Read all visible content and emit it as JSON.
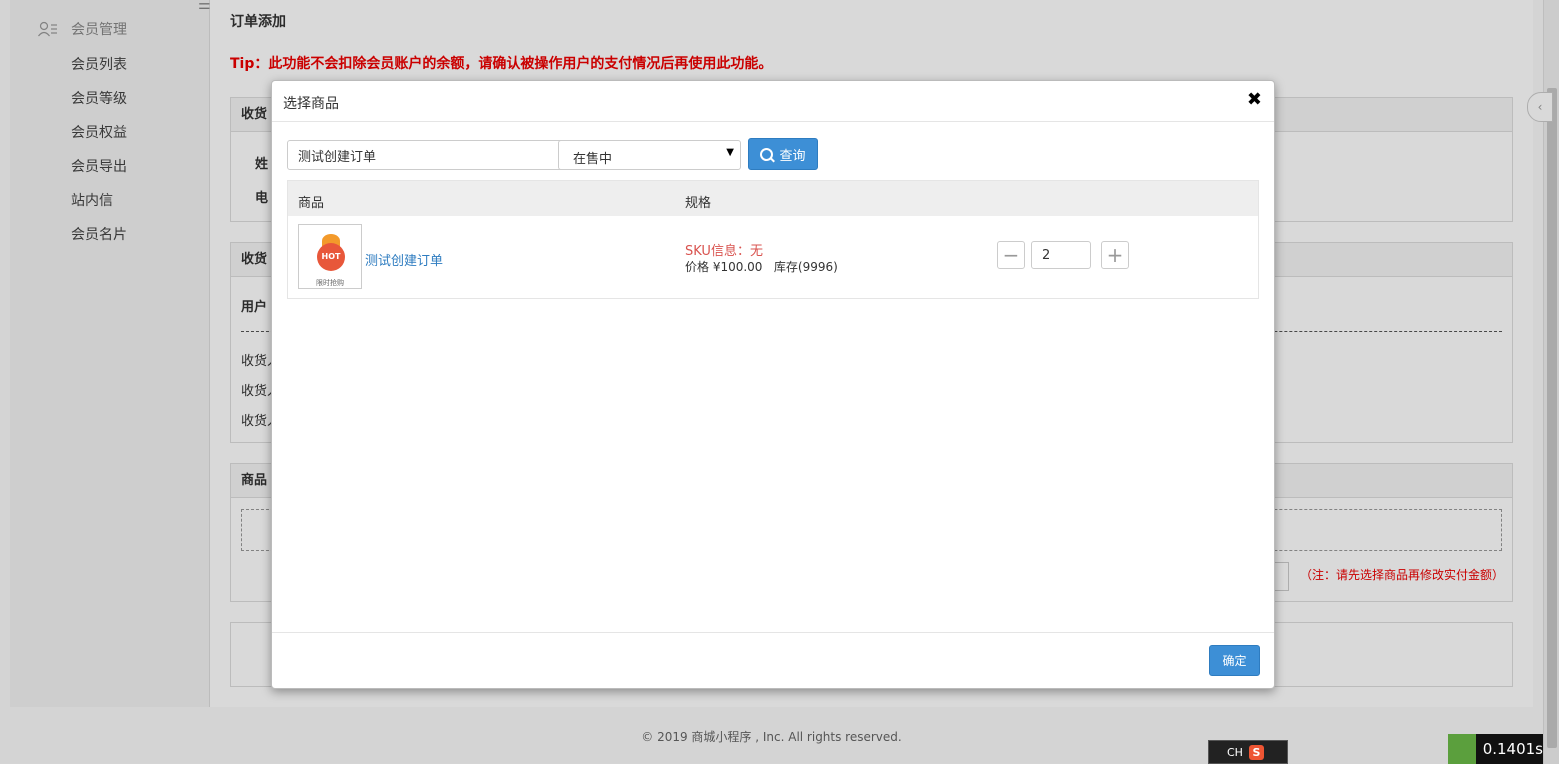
{
  "sidebar": {
    "section": "会员管理",
    "items": [
      {
        "label": "会员列表"
      },
      {
        "label": "会员等级"
      },
      {
        "label": "会员权益"
      },
      {
        "label": "会员导出"
      },
      {
        "label": "站内信"
      },
      {
        "label": "会员名片"
      }
    ]
  },
  "main": {
    "title": "订单添加",
    "tip": "Tip：此功能不会扣除会员账户的余额，请确认被操作用户的支付情况后再使用此功能。",
    "panel1": {
      "header": "收货",
      "label_name": "姓",
      "label_phone": "电"
    },
    "panel2": {
      "header": "收货",
      "label_user": "用户",
      "label_r1": "收货人",
      "label_r2": "收货人",
      "label_r3": "收货人"
    },
    "panel3": {
      "header": "商品",
      "note": "（注：请先选择商品再修改实付金额）"
    }
  },
  "footer": "© 2019 商城小程序 , Inc. All rights reserved.",
  "ime": {
    "label": "CH",
    "logo": "S"
  },
  "timer": "0.1401s",
  "modal": {
    "title": "选择商品",
    "search": {
      "value": "测试创建订单"
    },
    "status_select": {
      "value": "在售中"
    },
    "query_label": "查询",
    "columns": [
      "商品",
      "规格"
    ],
    "rows": [
      {
        "image_caption": "限时抢购",
        "image_badge": "HOT",
        "name": "测试创建订单",
        "sku": "SKU信息：无",
        "price_stock": "价格 ¥100.00   库存(9996)",
        "quantity": "2"
      }
    ],
    "confirm_label": "确定"
  }
}
